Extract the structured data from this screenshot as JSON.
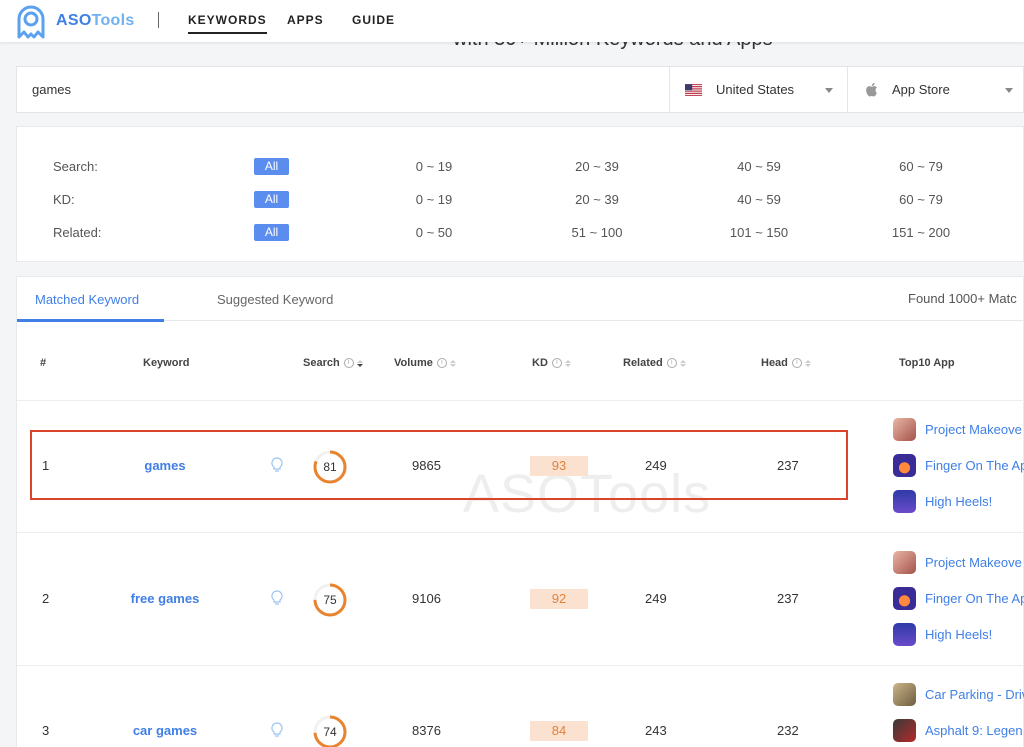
{
  "brand": {
    "aso": "ASO",
    "tools": "Tools"
  },
  "nav": [
    {
      "label": "KEYWORDS",
      "active": true
    },
    {
      "label": "APPS",
      "active": false
    },
    {
      "label": "GUIDE",
      "active": false
    }
  ],
  "headline_partial": "with 30+ Million Keywords and Apps",
  "search": {
    "value": "games",
    "country": "United States",
    "store": "App Store"
  },
  "filters": [
    {
      "label": "Search:",
      "all": "All",
      "ranges": [
        "0 ~ 19",
        "20 ~ 39",
        "40 ~ 59",
        "60 ~ 79"
      ]
    },
    {
      "label": "KD:",
      "all": "All",
      "ranges": [
        "0 ~ 19",
        "20 ~ 39",
        "40 ~ 59",
        "60 ~ 79"
      ]
    },
    {
      "label": "Related:",
      "all": "All",
      "ranges": [
        "0 ~ 50",
        "51 ~ 100",
        "101 ~ 150",
        "151 ~ 200"
      ]
    }
  ],
  "tabs": [
    {
      "label": "Matched Keyword",
      "active": true
    },
    {
      "label": "Suggested Keyword",
      "active": false
    }
  ],
  "found": "Found  1000+  Matc",
  "columns": [
    "#",
    "Keyword",
    "Search",
    "Volume",
    "KD",
    "Related",
    "Head",
    "Top10 App"
  ],
  "rows": [
    {
      "rank": "1",
      "keyword": "games",
      "search": 81,
      "volume": "9865",
      "kd": "93",
      "related": "249",
      "head": "237",
      "apps": [
        {
          "name": "Project Makeove",
          "icon": "makeover-app-icon",
          "color": "#c98a7c"
        },
        {
          "name": "Finger On The Ap",
          "icon": "finger-app-icon",
          "color": "#3a2c96"
        },
        {
          "name": "High Heels!",
          "icon": "heels-app-icon",
          "color": "#3b3fb0"
        }
      ]
    },
    {
      "rank": "2",
      "keyword": "free games",
      "search": 75,
      "volume": "9106",
      "kd": "92",
      "related": "249",
      "head": "237",
      "apps": [
        {
          "name": "Project Makeove",
          "icon": "makeover-app-icon",
          "color": "#c98a7c"
        },
        {
          "name": "Finger On The Ap",
          "icon": "finger-app-icon",
          "color": "#3a2c96"
        },
        {
          "name": "High Heels!",
          "icon": "heels-app-icon",
          "color": "#3b3fb0"
        }
      ]
    },
    {
      "rank": "3",
      "keyword": "car games",
      "search": 74,
      "volume": "8376",
      "kd": "84",
      "related": "243",
      "head": "232",
      "apps": [
        {
          "name": "Car Parking - Driv",
          "icon": "car-parking-app-icon",
          "color": "#8a7a5a"
        },
        {
          "name": "Asphalt 9: Legen",
          "icon": "asphalt-app-icon",
          "color": "#2c2c2c"
        }
      ]
    }
  ],
  "watermark": "ASOTools",
  "colors": {
    "accent": "#3f7fe6",
    "ring": "#e8832f",
    "kd_bg": "#fbe1cf",
    "kd_text": "#e0823e",
    "highlight": "#d9442a"
  }
}
